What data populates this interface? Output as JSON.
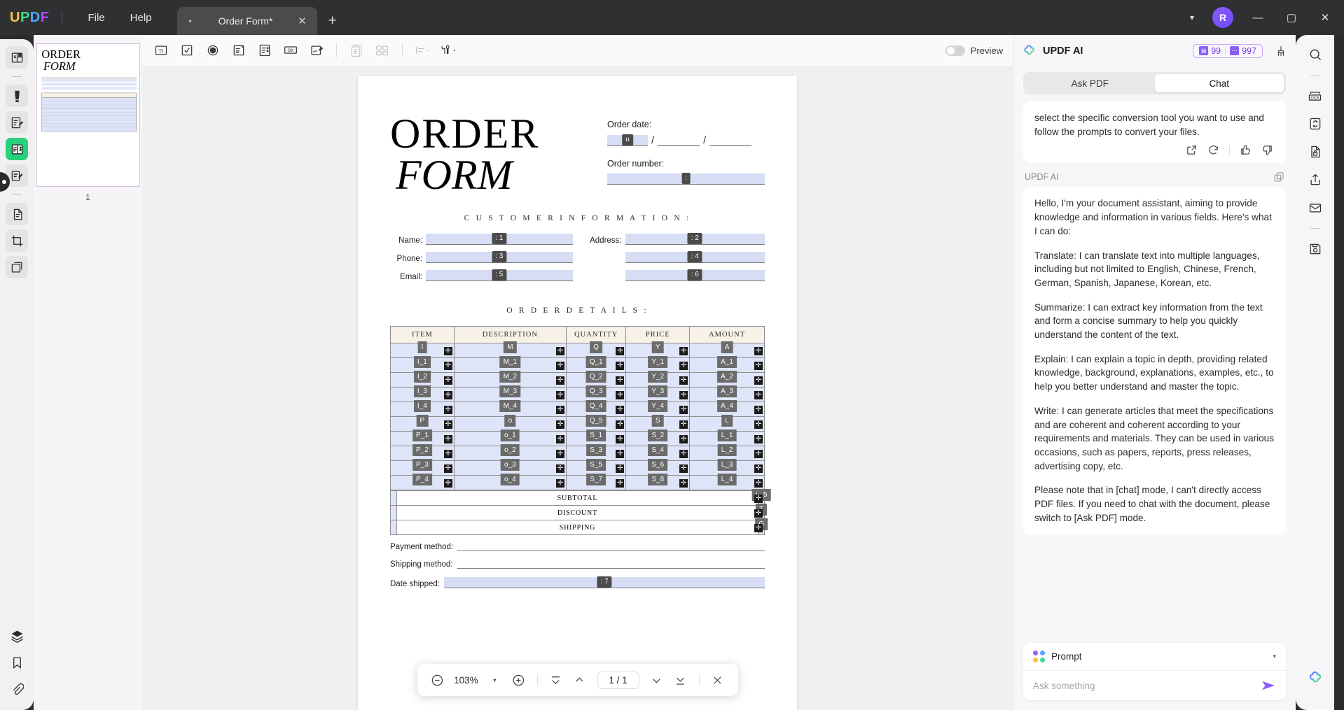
{
  "titlebar": {
    "logo": "UPDF",
    "menus": [
      "File",
      "Help"
    ],
    "tab": {
      "title": "Order Form*",
      "caret": "▾",
      "close": "✕"
    },
    "new_tab": "+",
    "chevron": "▾",
    "avatar_initial": "R",
    "window_buttons": {
      "minimize": "—",
      "maximize": "▢",
      "close": "✕"
    }
  },
  "left_rail": {
    "items": [
      {
        "name": "read-mode-icon",
        "label": "Reader"
      },
      {
        "name": "highlight-icon",
        "label": "Highlight"
      },
      {
        "name": "annotate-icon",
        "label": "Annotate"
      },
      {
        "name": "form-fields-icon",
        "label": "Prepare Form",
        "active": true
      },
      {
        "name": "edit-pdf-icon",
        "label": "Edit PDF"
      },
      {
        "name": "organize-pages-icon",
        "label": "Organize Pages"
      },
      {
        "name": "crop-icon",
        "label": "Crop"
      },
      {
        "name": "batch-icon",
        "label": "Batch"
      }
    ],
    "bottom": [
      {
        "name": "layers-icon",
        "label": "Layers"
      },
      {
        "name": "bookmark-icon",
        "label": "Bookmark"
      },
      {
        "name": "attachment-icon",
        "label": "Attachment"
      }
    ]
  },
  "thumbnails": {
    "page_label": "1"
  },
  "toolbar": {
    "tools": [
      {
        "name": "text-field-tool",
        "glyph": "TI"
      },
      {
        "name": "checkbox-tool",
        "glyph": "☑"
      },
      {
        "name": "radio-button-tool",
        "glyph": "◉"
      },
      {
        "name": "dropdown-tool",
        "glyph": "▤"
      },
      {
        "name": "list-box-tool",
        "glyph": "▥"
      },
      {
        "name": "push-button-tool",
        "glyph": "OK"
      },
      {
        "name": "signature-tool",
        "glyph": "✍"
      },
      {
        "name": "copy-tool",
        "glyph": "❐"
      },
      {
        "name": "grid-layout-tool",
        "glyph": "▦"
      },
      {
        "name": "align-tool",
        "glyph": "≡"
      },
      {
        "name": "form-settings-tool",
        "glyph": "⚙"
      }
    ],
    "preview_label": "Preview",
    "preview_on": false
  },
  "document": {
    "title_line1": "ORDER",
    "title_line2": "FORM",
    "order_date_label": "Order date:",
    "order_date_tag": "u",
    "order_number_label": "Order number:",
    "order_number_tag": ":",
    "customer_section": "C U S T O M E R   I N F O R M A T I O N :",
    "customer_fields": [
      {
        "label": "Name:",
        "tag": ": 1"
      },
      {
        "label": "Address:",
        "tag": ": 2"
      },
      {
        "label": "Phone:",
        "tag": ": 3"
      },
      {
        "label": "",
        "tag": ": 4"
      },
      {
        "label": "Email:",
        "tag": ": 5"
      },
      {
        "label": "",
        "tag": ": 6"
      }
    ],
    "order_section": "O R D E R   D E T A I L S :",
    "table_headers": [
      "ITEM",
      "DESCRIPTION",
      "QUANTITY",
      "PRICE",
      "AMOUNT"
    ],
    "table_rows": [
      [
        "I",
        "M",
        "Q",
        "Y",
        "A"
      ],
      [
        "I_1",
        "M_1",
        "Q_1",
        "Y_1",
        "A_1"
      ],
      [
        "I_2",
        "M_2",
        "Q_2",
        "Y_2",
        "A_2"
      ],
      [
        "I_3",
        "M_3",
        "Q_3",
        "Y_3",
        "A_3"
      ],
      [
        "I_4",
        "M_4",
        "Q_4",
        "Y_4",
        "A_4"
      ],
      [
        "P",
        "o",
        "Q_5",
        "S",
        "L"
      ],
      [
        "P_1",
        "o_1",
        "S_1",
        "S_2",
        "L_1"
      ],
      [
        "P_2",
        "o_2",
        "S_3",
        "S_4",
        "L_2"
      ],
      [
        "P_3",
        "o_3",
        "S_5",
        "S_6",
        "L_3"
      ],
      [
        "P_4",
        "o_4",
        "S_7",
        "S_8",
        "L_4"
      ]
    ],
    "totals": [
      {
        "label": "SUBTOTAL",
        "tag": "L_5"
      },
      {
        "label": "DISCOUNT",
        "tag": "T"
      },
      {
        "label": "SHIPPING",
        "tag": "G"
      }
    ],
    "bottom_labels": [
      {
        "label": "Payment method:",
        "tag": ""
      },
      {
        "label": "Shipping method:",
        "tag": ""
      },
      {
        "label": "Date shipped:",
        "tag": ": 7"
      }
    ],
    "plus_glyph": "✛"
  },
  "page_nav": {
    "zoom_out": "−",
    "zoom_value": "103%",
    "zoom_caret": "▾",
    "zoom_in": "+",
    "first_page": "⤒",
    "prev_page": "⌃",
    "page_indicator": "1 / 1",
    "next_page": "⌄",
    "last_page": "⤓",
    "close": "✕"
  },
  "ai_panel": {
    "title": "UPDF AI",
    "badges": [
      {
        "icon": "document-badge-icon",
        "value": "99"
      },
      {
        "icon": "chat-badge-icon",
        "value": "997"
      }
    ],
    "clean_icon": "broom-icon",
    "tabs": [
      {
        "label": "Ask PDF",
        "active": false
      },
      {
        "label": "Chat",
        "active": true
      }
    ],
    "previous_message": "select the specific conversion tool you want to use and follow the prompts to convert your files.",
    "message_actions": [
      "share-icon",
      "regenerate-icon",
      "thumbs-up-icon",
      "thumbs-down-icon"
    ],
    "assistant_name": "UPDF AI",
    "copy_icon": "copy-icon",
    "assistant_message": [
      "Hello, I'm your document assistant, aiming to provide knowledge and information in various fields. Here's what I can do:",
      "Translate: I can translate text into multiple languages, including but not limited to English, Chinese, French, German, Spanish, Japanese, Korean, etc.",
      "Summarize: I can extract key information from the text and form a concise summary to help you quickly understand the content of the text.",
      "Explain: I can explain a topic in depth, providing related knowledge, background, explanations, examples, etc., to help you better understand and master the topic.",
      "Write: I can generate articles that meet the specifications and are coherent and coherent according to your requirements and materials. They can be used in various occasions, such as papers, reports, press releases, advertising copy, etc.",
      "Please note that in [chat] mode, I can't directly access PDF files. If you need to chat with the document, please switch to [Ask PDF] mode."
    ],
    "prompt_label": "Prompt",
    "prompt_caret": "▾",
    "input_placeholder": "Ask something",
    "send_icon": "send-icon",
    "accent_purple": "#8b5cf6"
  },
  "right_rail": {
    "items": [
      {
        "name": "search-icon"
      },
      {
        "name": "ocr-icon"
      },
      {
        "name": "convert-icon"
      },
      {
        "name": "protect-icon"
      },
      {
        "name": "share-icon"
      },
      {
        "name": "email-icon"
      },
      {
        "name": "save-icon"
      },
      {
        "name": "ai-assistant-icon"
      }
    ]
  }
}
